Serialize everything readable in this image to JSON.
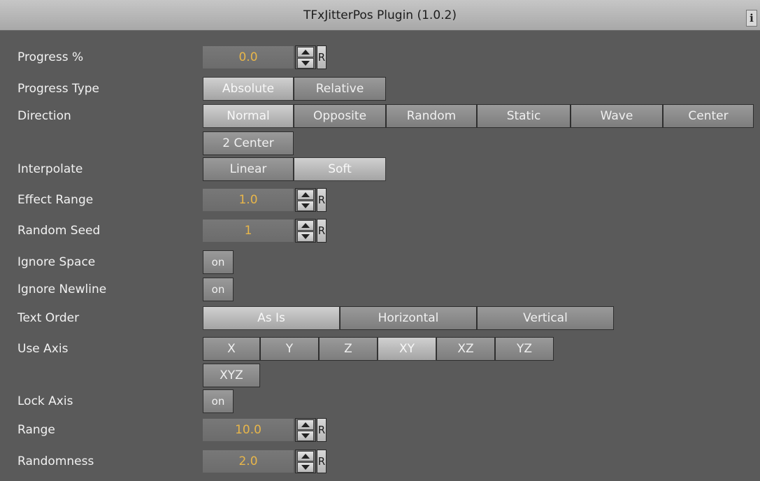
{
  "window": {
    "title": "TFxJitterPos Plugin (1.0.2)",
    "info_label": "i"
  },
  "rows": {
    "progress": {
      "label": "Progress %",
      "value": "0.0",
      "reset": "R"
    },
    "progress_type": {
      "label": "Progress Type",
      "options": [
        "Absolute",
        "Relative"
      ],
      "selected": "Absolute"
    },
    "direction": {
      "label": "Direction",
      "options": [
        "Normal",
        "Opposite",
        "Random",
        "Static",
        "Wave",
        "Center",
        "2 Center"
      ],
      "selected": "Normal"
    },
    "interpolate": {
      "label": "Interpolate",
      "options": [
        "Linear",
        "Soft"
      ],
      "selected": "Soft"
    },
    "effect_range": {
      "label": "Effect Range",
      "value": "1.0",
      "reset": "R"
    },
    "random_seed": {
      "label": "Random Seed",
      "value": "1",
      "reset": "R"
    },
    "ignore_space": {
      "label": "Ignore Space",
      "toggle": "on"
    },
    "ignore_newline": {
      "label": "Ignore Newline",
      "toggle": "on"
    },
    "text_order": {
      "label": "Text Order",
      "options": [
        "As Is",
        "Horizontal",
        "Vertical"
      ],
      "selected": "As Is"
    },
    "use_axis": {
      "label": "Use Axis",
      "options": [
        "X",
        "Y",
        "Z",
        "XY",
        "XZ",
        "YZ",
        "XYZ"
      ],
      "selected": "XY"
    },
    "lock_axis": {
      "label": "Lock Axis",
      "toggle": "on"
    },
    "range": {
      "label": "Range",
      "value": "10.0",
      "reset": "R"
    },
    "randomness": {
      "label": "Randomness",
      "value": "2.0",
      "reset": "R"
    }
  },
  "colors": {
    "value_text": "#e8b64a",
    "panel_bg": "#5a5a5a",
    "title_bg": "#b8b8b8"
  }
}
